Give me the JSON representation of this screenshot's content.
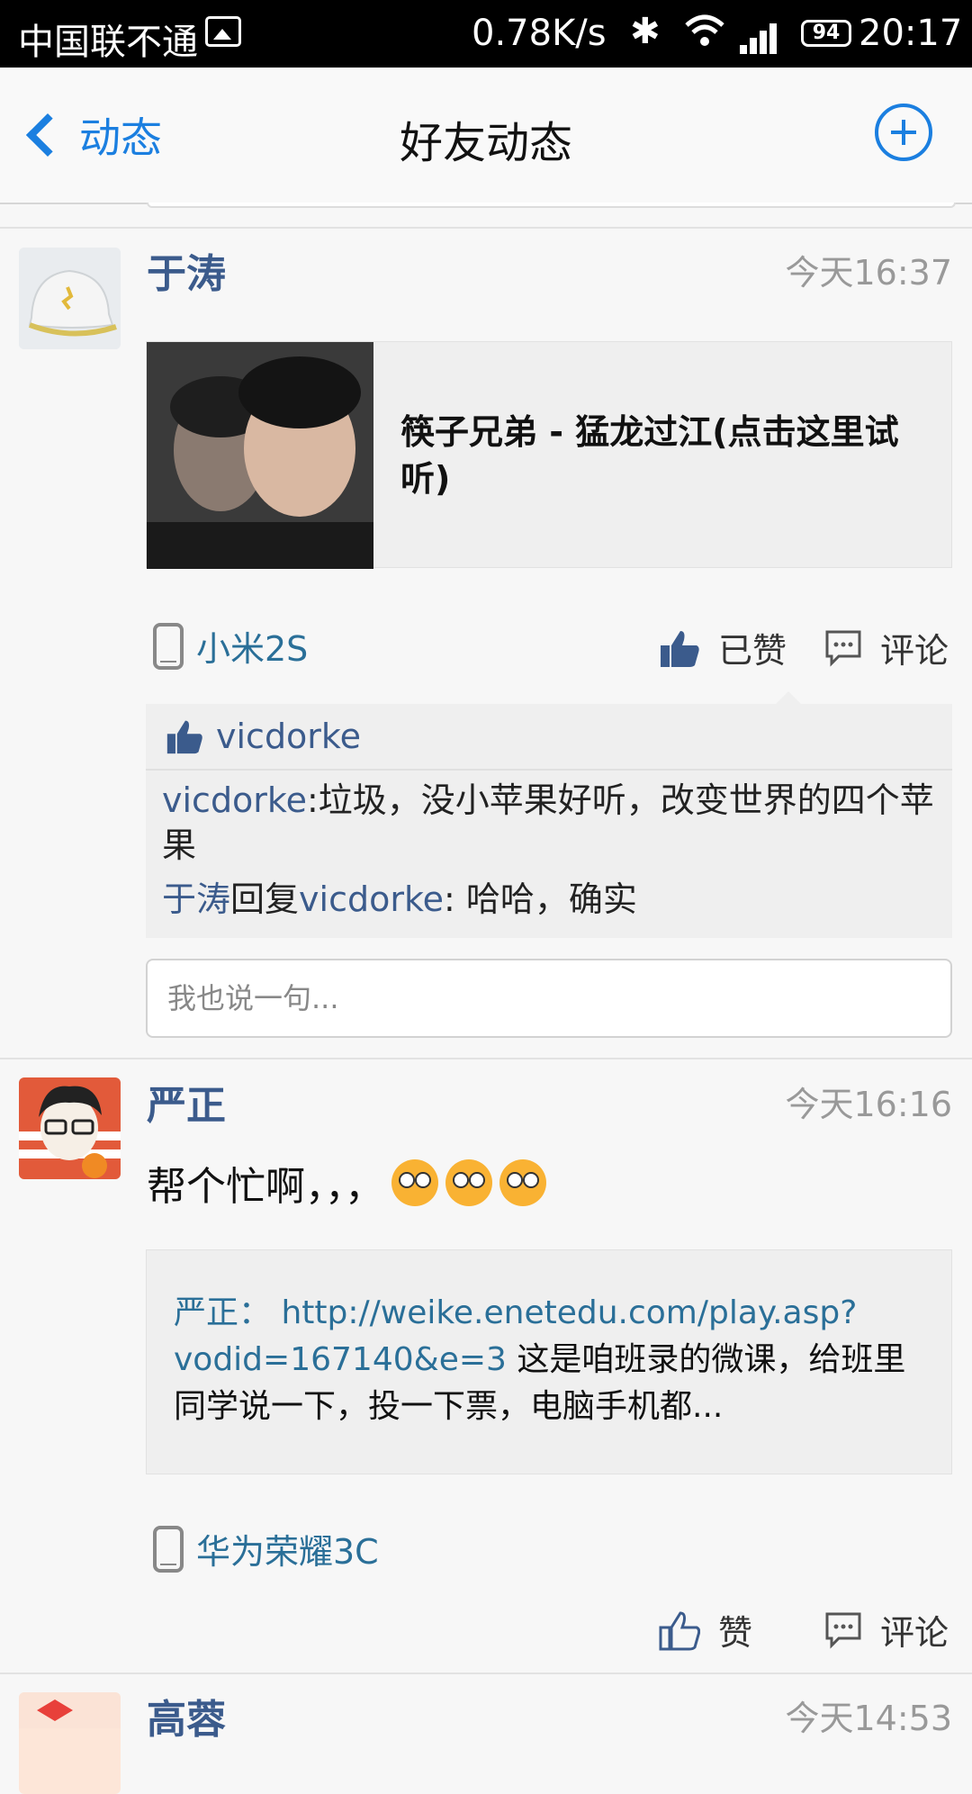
{
  "status_bar": {
    "carrier": "中国联不通",
    "speed": "0.78K/s",
    "battery": "94",
    "time": "20:17"
  },
  "nav": {
    "back_label": "动态",
    "title": "好友动态"
  },
  "posts": [
    {
      "author": "于涛",
      "time": "今天16:37",
      "share_title": "筷子兄弟 - 猛龙过江(点击这里试听)",
      "device": "小米2S",
      "like_label": "已赞",
      "comment_label": "评论",
      "liked_by": "vicdorke",
      "comments": [
        {
          "user": "vicdorke",
          "sep": ":",
          "text": "垃圾，没小苹果好听，改变世界的四个苹果"
        },
        {
          "user": "于涛",
          "reply_word": "回复",
          "reply_to": "vicdorke",
          "sep": ": ",
          "text": "哈哈，确实"
        }
      ],
      "input_placeholder": "我也说一句..."
    },
    {
      "author": "严正",
      "time": "今天16:16",
      "text": "帮个忙啊，，，",
      "link_author": "严正：",
      "link_url": "http://weike.enetedu.com/play.asp?vodid=167140&e=3",
      "link_text": "这是咱班录的微课，给班里同学说一下，投一下票，电脑手机都...",
      "device": "华为荣耀3C",
      "like_label": "赞",
      "comment_label": "评论"
    },
    {
      "author": "高蓉",
      "time": "今天14:53"
    }
  ],
  "colors": {
    "accent": "#1b7fe0",
    "name": "#3b5b8c",
    "link": "#2a6f98"
  }
}
